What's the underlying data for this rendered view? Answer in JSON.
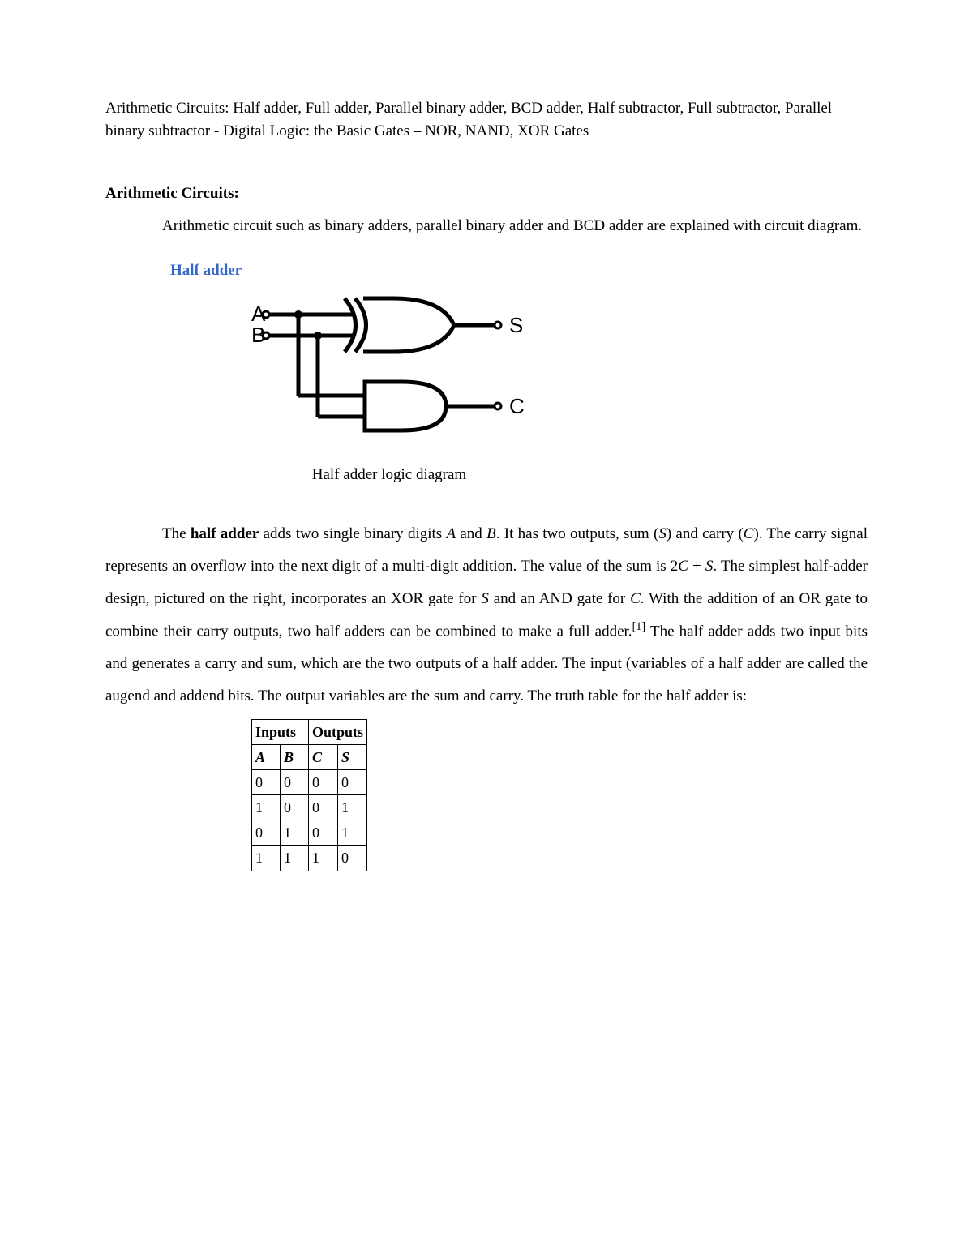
{
  "topic_list": "Arithmetic Circuits: Half adder, Full adder, Parallel binary adder, BCD adder, Half subtractor, Full subtractor, Parallel binary subtractor - Digital Logic: the Basic Gates – NOR, NAND, XOR Gates",
  "section_heading": "Arithmetic Circuits:",
  "intro_para": "Arithmetic circuit such as binary adders, parallel binary adder and BCD adder are explained with circuit diagram.",
  "subheading": "Half adder",
  "diagram_labels": {
    "A": "A",
    "B": "B",
    "S": "S",
    "C": "C"
  },
  "diagram_caption": "Half adder logic diagram",
  "para_parts": {
    "p1": "The ",
    "bold1": "half adder",
    "p2": " adds two single binary digits ",
    "iA": "A",
    "p3": " and ",
    "iB": "B",
    "p4": ". It has two outputs, sum (",
    "iS": "S",
    "p5": ") and carry (",
    "iC": "C",
    "p6": "). The carry signal represents an overflow into the next digit of a multi-digit addition. The value of the sum is 2",
    "iC2": "C",
    "p7": " + ",
    "iS2": "S",
    "p8": ". The simplest half-adder design, pictured on the right, incorporates an XOR gate for ",
    "iS3": "S",
    "p9": " and an AND gate for ",
    "iC3": "C",
    "p10": ". With the addition of an OR gate to combine their carry outputs, two half adders can be combined to make a full adder.",
    "sup": "[1]",
    "p11": " The half adder adds two input bits and generates a carry and sum, which are the two outputs of a half adder. The input (variables of a half adder are called the augend and addend bits. The output variables are the sum and carry. The truth table for the half adder is:"
  },
  "table": {
    "head_inputs": "Inputs",
    "head_outputs": "Outputs",
    "cols": {
      "A": "A",
      "B": "B",
      "C": "C",
      "S": "S"
    },
    "rows": [
      {
        "A": "0",
        "B": "0",
        "C": "0",
        "S": "0"
      },
      {
        "A": "1",
        "B": "0",
        "C": "0",
        "S": "1"
      },
      {
        "A": "0",
        "B": "1",
        "C": "0",
        "S": "1"
      },
      {
        "A": "1",
        "B": "1",
        "C": "1",
        "S": "0"
      }
    ]
  }
}
